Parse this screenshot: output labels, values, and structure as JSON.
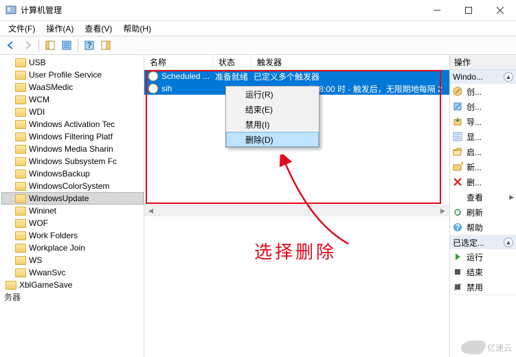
{
  "window": {
    "title": "计算机管理"
  },
  "menus": {
    "file": "文件(F)",
    "action": "操作(A)",
    "view": "查看(V)",
    "help": "帮助(H)"
  },
  "tree": {
    "items": [
      {
        "label": "USB"
      },
      {
        "label": "User Profile Service"
      },
      {
        "label": "WaaSMedic"
      },
      {
        "label": "WCM"
      },
      {
        "label": "WDI"
      },
      {
        "label": "Windows Activation Tec"
      },
      {
        "label": "Windows Filtering Platf"
      },
      {
        "label": "Windows Media Sharin"
      },
      {
        "label": "Windows Subsystem Fc"
      },
      {
        "label": "WindowsBackup"
      },
      {
        "label": "WindowsColorSystem"
      },
      {
        "label": "WindowsUpdate"
      },
      {
        "label": "Wininet"
      },
      {
        "label": "WOF"
      },
      {
        "label": "Work Folders"
      },
      {
        "label": "Workplace Join"
      },
      {
        "label": "WS"
      },
      {
        "label": "WwanSvc"
      }
    ],
    "outdent_item": "XblGameSave",
    "truncated": "务器"
  },
  "list": {
    "columns": {
      "name": "名称",
      "status": "状态",
      "triggers": "触发器"
    },
    "rows": [
      {
        "name": "Scheduled ...",
        "status": "准备就绪",
        "triggers": "已定义多个触发器"
      },
      {
        "name": "sih",
        "status": "",
        "triggers": "的 8:00 时 - 触发后，无限期地每隔 2"
      }
    ]
  },
  "context_menu": {
    "run": "运行(R)",
    "end": "结束(E)",
    "disable": "禁用(I)",
    "delete": "删除(D)"
  },
  "annotation": "选择删除",
  "actions": {
    "header": "操作",
    "group1_title": "Windo...",
    "group1": [
      {
        "icon": "wand",
        "label": "创..."
      },
      {
        "icon": "wand-alt",
        "label": "创..."
      },
      {
        "icon": "import",
        "label": "导..."
      },
      {
        "icon": "list",
        "label": "显..."
      },
      {
        "icon": "folder-open",
        "label": "启..."
      },
      {
        "icon": "folder-new",
        "label": "新..."
      },
      {
        "icon": "delete-x",
        "label": "删..."
      },
      {
        "icon": "view",
        "label": "查看",
        "submenu": true
      },
      {
        "icon": "refresh",
        "label": "刷新"
      },
      {
        "icon": "help",
        "label": "帮助"
      }
    ],
    "group2_title": "已选定...",
    "group2": [
      {
        "icon": "play",
        "label": "运行"
      },
      {
        "icon": "stop",
        "label": "结束"
      },
      {
        "icon": "disable",
        "label": "禁用"
      }
    ]
  },
  "watermark": "亿速云"
}
